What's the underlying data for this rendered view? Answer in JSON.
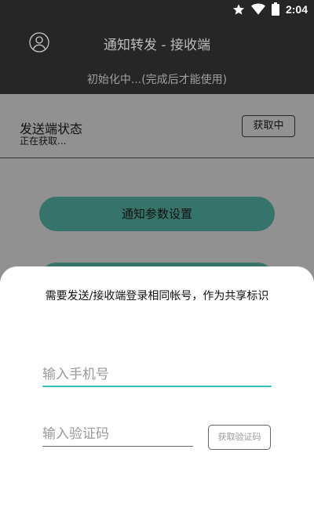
{
  "status_bar": {
    "time": "2:04",
    "icons": [
      "star-icon",
      "wifi-icon",
      "battery-icon"
    ]
  },
  "app_bar": {
    "title": "通知转发 - 接收端",
    "leading_icon": "account-circle-icon"
  },
  "init_status": "初始化中...(完成后才能使用)",
  "sender": {
    "title": "发送端状态",
    "status": "正在获取...",
    "fetch_button": "获取中"
  },
  "buttons": {
    "notify_settings": "通知参数设置"
  },
  "login_sheet": {
    "hint": "需要发送/接收端登录相同帐号，作为共享标识",
    "phone_placeholder": "输入手机号",
    "code_placeholder": "输入验证码",
    "get_code_button": "获取验证码"
  },
  "colors": {
    "toolbar": "#262626",
    "accent_teal": "#5fcabb",
    "input_focus": "#36c2c0"
  }
}
